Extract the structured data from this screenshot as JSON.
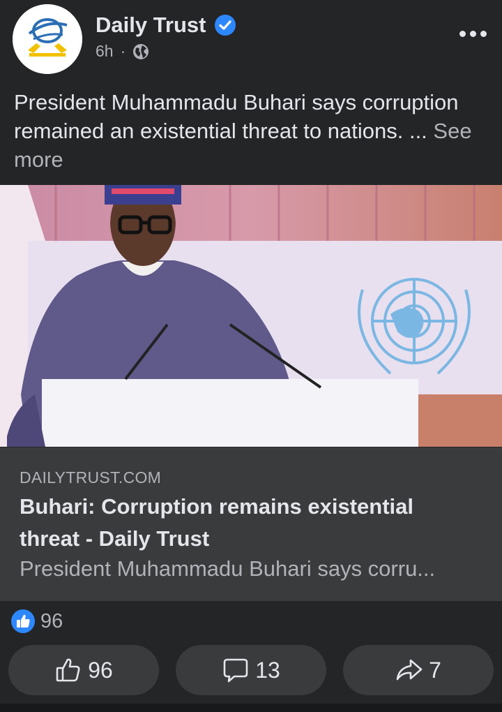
{
  "post": {
    "page_name": "Daily Trust",
    "time": "6h",
    "separator": "·",
    "caption": "President Muhammadu Buhari says corruption remained an existential threat to nations.",
    "ellipsis": " ... ",
    "see_more": "See more"
  },
  "link_preview": {
    "domain": "DAILYTRUST.COM",
    "title": "Buhari: Corruption remains existential threat - Daily Trust",
    "description": "President Muhammadu Buhari says corru..."
  },
  "reactions": {
    "count": "96"
  },
  "actions": {
    "like_count": "96",
    "comment_count": "13",
    "share_count": "7"
  },
  "colors": {
    "background": "#242526",
    "card": "#3a3b3c",
    "accent_blue": "#2d88ff",
    "logo_yellow": "#f2c200"
  },
  "icons": {
    "verified": "verified-badge-icon",
    "audience": "globe-icon",
    "more": "more-options-icon",
    "like": "thumbs-up-icon",
    "comment": "comment-icon",
    "share": "share-icon"
  }
}
